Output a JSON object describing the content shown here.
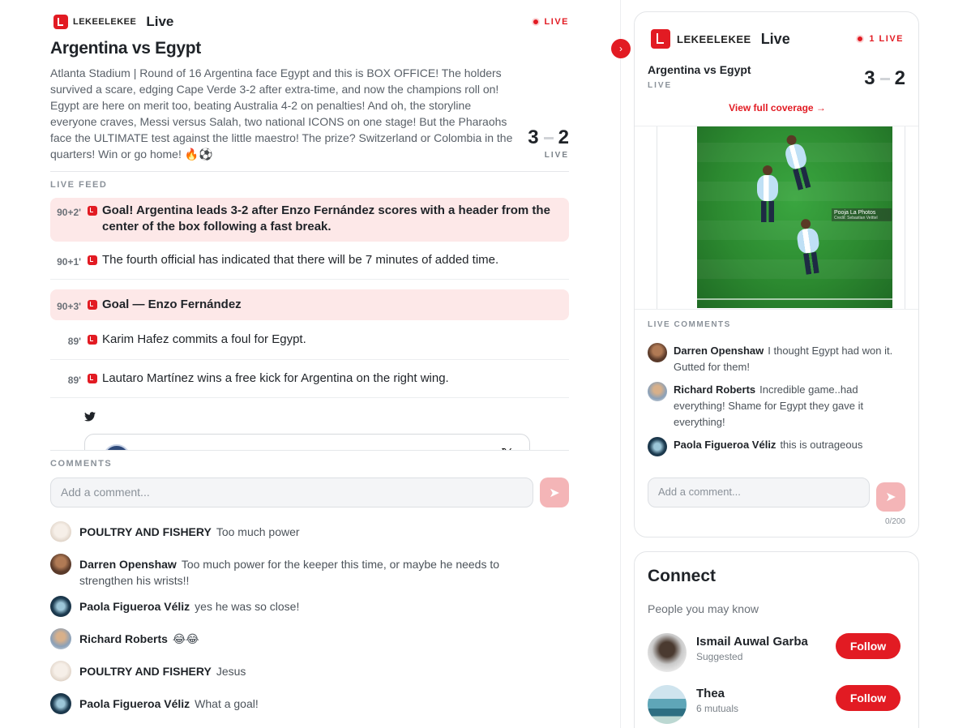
{
  "brand": {
    "logo_text": "LEKEELEKEE",
    "section": "Live",
    "live_badge": "LIVE"
  },
  "match": {
    "title": "Argentina vs Egypt",
    "description": "Atlanta Stadium | Round of 16 Argentina face Egypt and this is BOX OFFICE! The holders survived a scare, edging Cape Verde 3-2 after extra-time, and now the champions roll on! Egypt are here on merit too, beating Australia 4-2 on penalties! And oh, the storyline everyone craves, Messi versus Salah, two national ICONS on one stage! But the Pharaohs face the ULTIMATE test against the little maestro! The prize? Switzerland or Colombia in the quarters! Win or go home! 🔥⚽",
    "home_score": "3",
    "away_score": "2",
    "status": "LIVE"
  },
  "feed": {
    "label": "LIVE FEED",
    "items": [
      {
        "minute": "90+2'",
        "text": "Goal! Argentina leads 3-2 after Enzo Fernández scores with a header from the center of the box following a fast break."
      },
      {
        "minute": "90+1'",
        "text": "The fourth official has indicated that there will be 7 minutes of added time."
      },
      {
        "minute": "90+3'",
        "text": "Goal — Enzo Fernández"
      },
      {
        "minute": "89'",
        "text": "Karim Hafez commits a foul for Egypt."
      },
      {
        "minute": "89'",
        "text": "Lautaro Martínez wins a free kick for Argentina on the right wing."
      }
    ]
  },
  "comments": {
    "label": "COMMENTS",
    "placeholder": "Add a comment...",
    "items": [
      {
        "name": "POULTRY AND FISHERY",
        "text": "Too much power"
      },
      {
        "name": "Darren Openshaw",
        "text": "Too much power for the keeper this time, or maybe he needs to strengthen his wrists!!"
      },
      {
        "name": "Paola Figueroa Véliz",
        "text": "yes he was so close!"
      },
      {
        "name": "Richard Roberts",
        "text": "😂😂"
      },
      {
        "name": "POULTRY AND FISHERY",
        "text": "Jesus"
      },
      {
        "name": "Paola Figueroa Véliz",
        "text": "What a goal!"
      }
    ]
  },
  "widget": {
    "live_badge": "1 LIVE",
    "title": "Argentina vs Egypt",
    "status": "LIVE",
    "home_score": "3",
    "away_score": "2",
    "full_coverage": "View full coverage →",
    "photo_credit": "Pooja La Photos",
    "photo_credit_sub": "Credit: Sebastian Vetttel",
    "live_comments_label": "LIVE COMMENTS",
    "live_comments": [
      {
        "name": "Darren Openshaw",
        "text": "I thought Egypt had won it. Gutted for them!"
      },
      {
        "name": "Richard Roberts",
        "text": "Incredible game..had everything! Shame for Egypt they gave it everything!"
      },
      {
        "name": "Paola Figueroa Véliz",
        "text": "this is outrageous"
      }
    ],
    "placeholder": "Add a comment...",
    "char_count": "0/200"
  },
  "connect": {
    "title": "Connect",
    "subtitle": "People you may know",
    "people": [
      {
        "name": "Ismail Auwal Garba",
        "meta": "Suggested",
        "action": "Follow"
      },
      {
        "name": "Thea",
        "meta": "6 mutuals",
        "action": "Follow"
      }
    ]
  },
  "colors": {
    "accent": "#e21b23",
    "goal_bg": "#fde8e8",
    "send_disabled": "#f4b5b7"
  }
}
